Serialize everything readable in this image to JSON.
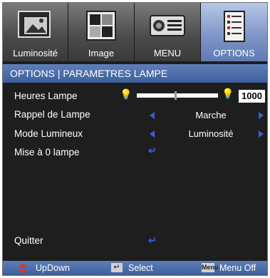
{
  "tabs": [
    {
      "label": "Luminosité",
      "icon": "picture-icon",
      "active": false
    },
    {
      "label": "Image",
      "icon": "image-icon",
      "active": false
    },
    {
      "label": "MENU",
      "icon": "projector-icon",
      "active": false
    },
    {
      "label": "OPTIONS",
      "icon": "options-list-icon",
      "active": true
    }
  ],
  "section_title": "OPTIONS | PARAMETRES LAMPE",
  "rows": {
    "heures_lampe": {
      "label": "Heures Lampe",
      "value": "1000",
      "slider_fraction": 0.47
    },
    "rappel_lampe": {
      "label": "Rappel de Lampe",
      "value": "Marche"
    },
    "mode_lumineux": {
      "label": "Mode Lumineux",
      "value": "Luminosité"
    },
    "mise_a_zero": {
      "label": "Mise à 0 lampe"
    },
    "quitter": {
      "label": "Quitter"
    }
  },
  "footer": {
    "updown": "UpDown",
    "select": "Select",
    "menu_off": "Menu Off",
    "menu_key": "Menu"
  },
  "colors": {
    "accent_blue": "#3b5fd0",
    "active_tab": "#7f97c7",
    "background": "#1e1e1e"
  }
}
